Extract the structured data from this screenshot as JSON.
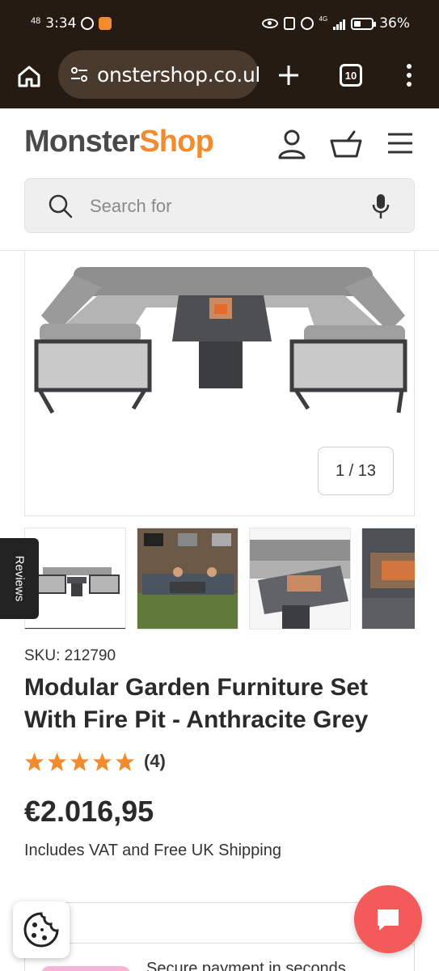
{
  "status_bar": {
    "small_label": "48",
    "time": "3:34",
    "lte_label": "4G",
    "battery": "36%"
  },
  "browser": {
    "url": "onstershop.co.uk",
    "tab_count": "10"
  },
  "header": {
    "logo_part1": "Monster",
    "logo_part2": "Shop",
    "search_placeholder": "Search for"
  },
  "gallery": {
    "counter": "1 / 13",
    "reviews_tab": "Reviews"
  },
  "product": {
    "sku": "SKU: 212790",
    "title": "Modular Garden Furniture Set With Fire Pit - Anthracite Grey",
    "rating": 5,
    "rating_count": "(4)",
    "price": "€2.016,95",
    "vat_note": "Includes VAT and Free UK Shipping",
    "payment_text": "Secure payment in seconds"
  },
  "colors": {
    "brand_orange": "#f28a2e",
    "brand_grey": "#4a4a4a",
    "browser_chrome": "#261b13",
    "chat_red": "#f35b5b",
    "star": "#f28a2e"
  },
  "icons": [
    "home-icon",
    "site-settings-icon",
    "plus-icon",
    "tabs-icon",
    "more-icon",
    "user-icon",
    "basket-icon",
    "hamburger-icon",
    "search-icon",
    "mic-icon",
    "star-icon",
    "cookie-icon",
    "chat-icon"
  ]
}
